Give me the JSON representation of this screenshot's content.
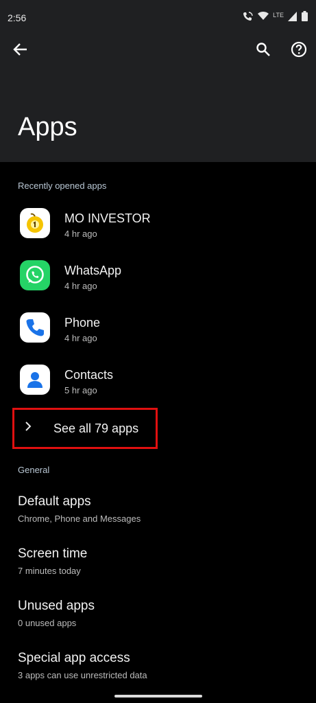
{
  "status_bar": {
    "time": "2:56",
    "network": "LTE"
  },
  "header": {
    "title": "Apps"
  },
  "sections": {
    "recent": "Recently opened apps",
    "general": "General"
  },
  "recent_apps": [
    {
      "name": "MO INVESTOR",
      "time": "4 hr ago"
    },
    {
      "name": "WhatsApp",
      "time": "4 hr ago"
    },
    {
      "name": "Phone",
      "time": "4 hr ago"
    },
    {
      "name": "Contacts",
      "time": "5 hr ago"
    }
  ],
  "see_all": "See all 79 apps",
  "general": [
    {
      "title": "Default apps",
      "subtitle": "Chrome, Phone and Messages"
    },
    {
      "title": "Screen time",
      "subtitle": "7 minutes today"
    },
    {
      "title": "Unused apps",
      "subtitle": "0 unused apps"
    },
    {
      "title": "Special app access",
      "subtitle": "3 apps can use unrestricted data"
    }
  ],
  "colors": {
    "header_bg": "#1f2022",
    "highlight_border": "#e01010",
    "whatsapp_green": "#25d366"
  }
}
